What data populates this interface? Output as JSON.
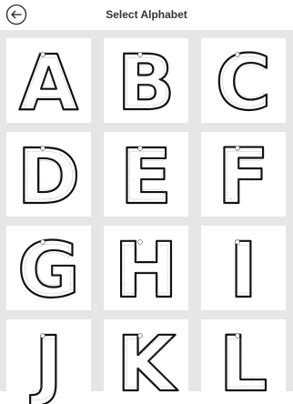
{
  "header": {
    "title": "Select Alphabet",
    "back_icon": "back-arrow-icon"
  },
  "letters": [
    "A",
    "B",
    "C",
    "D",
    "E",
    "F",
    "G",
    "H",
    "I",
    "J",
    "K",
    "L"
  ]
}
